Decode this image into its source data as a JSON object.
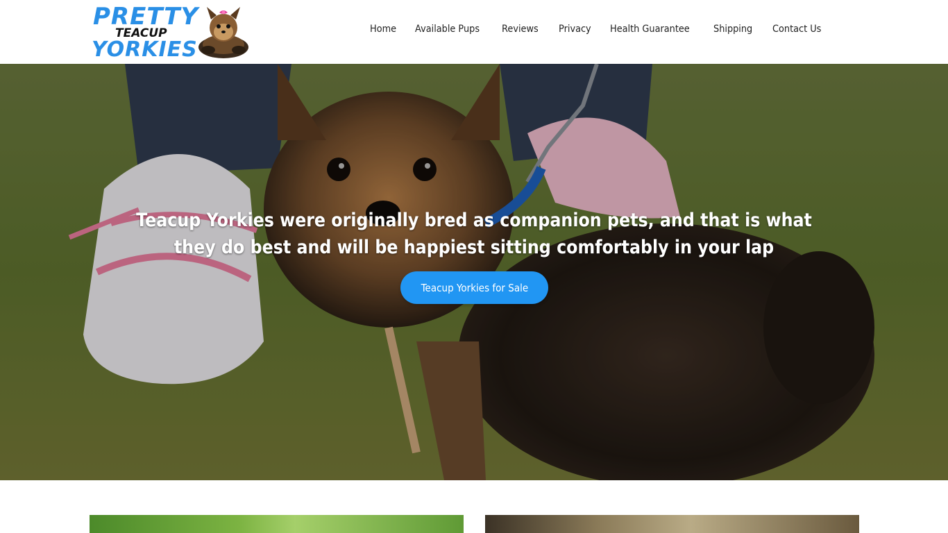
{
  "logo": {
    "line1": "PRETTY",
    "line2": "TEACUP",
    "line3": "YORKIES",
    "icon": "yorkie-dog-icon",
    "brand_color": "#2a8fe6"
  },
  "nav": {
    "items": [
      {
        "label": "Home"
      },
      {
        "label": "Available Pups"
      },
      {
        "label": "Reviews"
      },
      {
        "label": "Privacy"
      },
      {
        "label": "Health Guarantee"
      },
      {
        "label": "Shipping"
      },
      {
        "label": "Contact Us"
      }
    ]
  },
  "hero": {
    "headline": "Teacup Yorkies were originally bred as companion pets, and that is what they do best and will be happiest sitting comfortably in your lap",
    "cta_label": "Teacup Yorkies for Sale",
    "cta_color": "#2196f3"
  }
}
